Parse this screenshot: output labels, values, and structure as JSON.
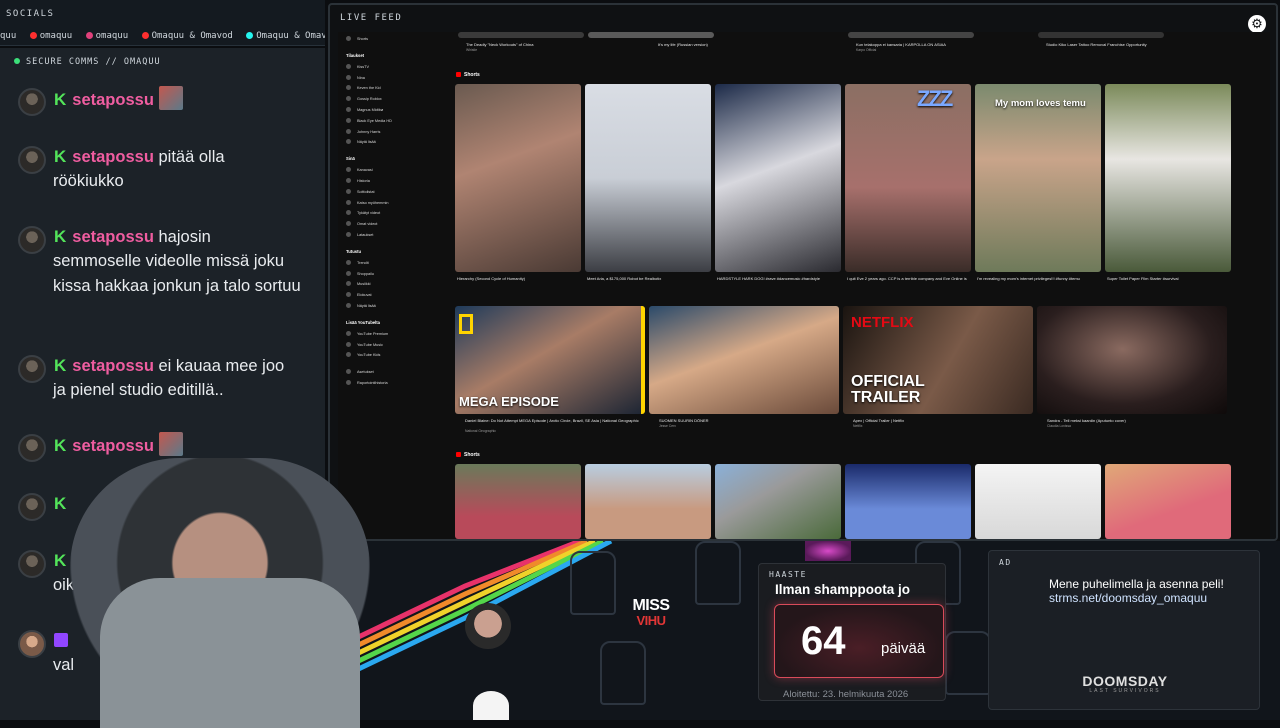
{
  "socials": {
    "title": "SOCIALS",
    "handles": [
      "quu",
      "omaquu",
      "omaquu",
      "Omaquu & Omavod",
      "Omaquu & Omavod"
    ]
  },
  "chat": {
    "header": "SECURE COMMS // OMAQUU",
    "messages": [
      {
        "name": "setapossu",
        "text": "",
        "emote": true
      },
      {
        "name": "setapossu",
        "text": "pitää olla",
        "continuation": "röökiukko"
      },
      {
        "name": "setapossu",
        "text": "hajosin",
        "continuation": "semmoselle videolle missä joku kissa hakkaa jonkun ja talo sortuu"
      },
      {
        "name": "setapossu",
        "text": "ei kauaa mee joo",
        "continuation": "ja pienel studio editillä.."
      },
      {
        "name": "setapossu",
        "text": "",
        "emote": true
      }
    ],
    "partial_1": "oikeusjuttu",
    "partial_2": "val"
  },
  "feed": {
    "title": "LIVE FEED",
    "youtube": {
      "sidebar_sections": [
        {
          "head": "",
          "items": [
            "Shorts"
          ]
        },
        {
          "head": "Tilaukset",
          "items": [
            "KissTV",
            "Nina",
            "Keven the Kid",
            "Gossip Roblox",
            "Magnus Midtbø",
            "Black Eye Media HD",
            "Johnny Harris",
            "Näytä lisää"
          ]
        },
        {
          "head": "Sinä",
          "items": [
            "Kanavasi",
            "Historia",
            "Soittolistat",
            "Katso myöhemmin",
            "Tykätyt videot",
            "Omat videot",
            "Lataukset"
          ]
        },
        {
          "head": "Tutustu",
          "items": [
            "Trendit",
            "Shoppailu",
            "Musiikki",
            "Elokuvat",
            "Näytä lisää"
          ]
        },
        {
          "head": "Lisää YouTubelta",
          "items": [
            "YouTube Premium",
            "YouTube Music",
            "YouTube Kids"
          ]
        },
        {
          "head": "",
          "items": [
            "Asetukset",
            "Raportointihistoria"
          ]
        }
      ],
      "top_row": [
        {
          "title": "The Deadly \"Neck Workouts\" of China",
          "meta": "Whistle"
        },
        {
          "title": "It's my life (Russian version)",
          "meta": ""
        },
        {
          "title": "Kun telakoppa ei kansaria | KARPOLLA ON ASIAA",
          "meta": "Karpo Official"
        },
        {
          "title": "Studio Kiko Laser Tattoo Removal Franchise Opportunity",
          "meta": ""
        }
      ],
      "shorts_label": "Shorts",
      "shorts_1": [
        {
          "title": "Hierarchy (Second Cycle of Humanity)",
          "overlay": ""
        },
        {
          "title": "Meet Aria, a $175,000 Robot be Realbotix",
          "overlay": ""
        },
        {
          "title": "HARDSTYLE HARK DOG! #rave #dancemusic #hardstyle",
          "overlay": ""
        },
        {
          "title": "I quit Eve 2 years ago. CCP is a terrible company and Eve Online is in Maintenance mode.",
          "overlay": "ZZZ"
        },
        {
          "title": "I'm revealing my mom's internet privileges!!! #funny #temu",
          "overlay": "My mom loves temu"
        },
        {
          "title": "Super Toilet Paper Film Starter #survival",
          "overlay": ""
        }
      ],
      "videos": [
        {
          "title": "Daniel Blaine: Do Not Attempt MEGA Episode | Arctic Circle, Brazil, SE Asia | National Geographic",
          "meta": "National Geographic",
          "overlay": "MEGA EPISODE"
        },
        {
          "title": "SUOMEN SUURIN DÖNER",
          "meta": "Jesse Cerv",
          "overlay": ""
        },
        {
          "title": "Apex | Official Trailer | Netflix",
          "meta": "Netflix",
          "overlay": "OFFICIAL TRAILER",
          "brand": "NETFLIX"
        },
        {
          "title": "Sandra - Tell meksi kaardin (Aputunto cover)",
          "meta": "Claudia Lovissa",
          "overlay": ""
        }
      ],
      "shorts_2_label": "Shorts"
    }
  },
  "overlay": {
    "miss_top": "MISS",
    "miss_bottom": "VIHU"
  },
  "haaste": {
    "label": "HAASTE",
    "question": "Ilman shamppoota jo",
    "count": "64",
    "unit": "päivää",
    "since": "Aloitettu: 23. helmikuuta 2026"
  },
  "ad": {
    "label": "AD",
    "line1": "Mene puhelimella ja asenna peli!",
    "line2": "strms.net/doomsday_omaquu",
    "logo": "DOOMSDAY",
    "logo_sub": "LAST SURVIVORS"
  },
  "colors": {
    "username": "#ef5da0",
    "badge": "#53e45a",
    "accent_red": "#d94b5a"
  }
}
